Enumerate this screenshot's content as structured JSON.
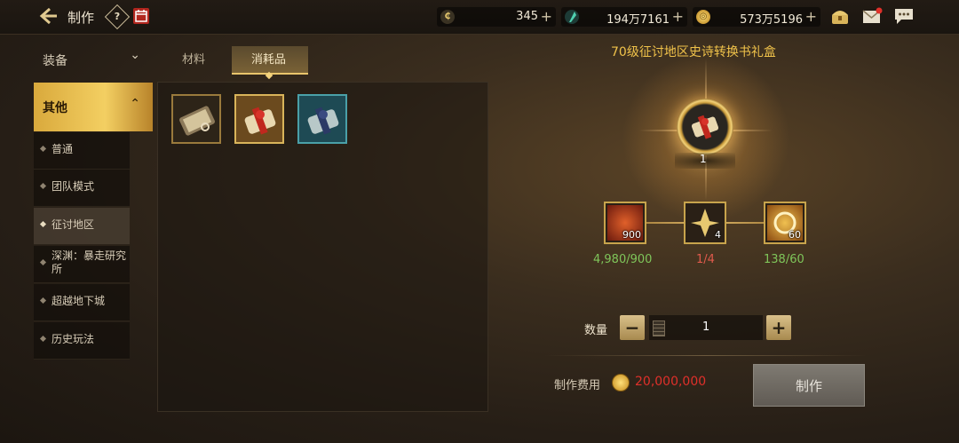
{
  "header": {
    "title": "制作",
    "help_label": "?",
    "currencies": [
      {
        "name": "c-coin",
        "value": "345"
      },
      {
        "name": "gem",
        "value": "194万7161"
      },
      {
        "name": "gold",
        "value": "573万5196"
      }
    ],
    "icons": [
      "treasure-chest-icon",
      "mail-icon",
      "chat-icon"
    ]
  },
  "sidebar": {
    "category_equip": "装备",
    "category_other": "其他",
    "items": [
      {
        "label": "普通",
        "active": false
      },
      {
        "label": "团队模式",
        "active": false
      },
      {
        "label": "征讨地区",
        "active": true
      },
      {
        "label": "深渊：暴走研究所",
        "active": false
      },
      {
        "label": "超越地下城",
        "active": false
      },
      {
        "label": "历史玩法",
        "active": false
      }
    ]
  },
  "tabs": {
    "materials": "材料",
    "consumables": "消耗品"
  },
  "grid_items": [
    {
      "name": "scroll-item-1"
    },
    {
      "name": "gift-box-item-selected"
    },
    {
      "name": "blue-box-item"
    }
  ],
  "recipe": {
    "title": "70级征讨地区史诗转换书礼盒",
    "output_qty": "1",
    "materials": [
      {
        "name": "red-crystal-material",
        "count": "900",
        "have": "4,980/900",
        "enough": true
      },
      {
        "name": "gold-leaf-material",
        "count": "4",
        "have": "1/4",
        "enough": false
      },
      {
        "name": "gold-ring-material",
        "count": "60",
        "have": "138/60",
        "enough": true
      }
    ]
  },
  "quantity": {
    "label": "数量",
    "minus": "−",
    "plus": "+",
    "value": "1"
  },
  "cost": {
    "label": "制作费用",
    "value": "20,000,000"
  },
  "make_button": "制作"
}
